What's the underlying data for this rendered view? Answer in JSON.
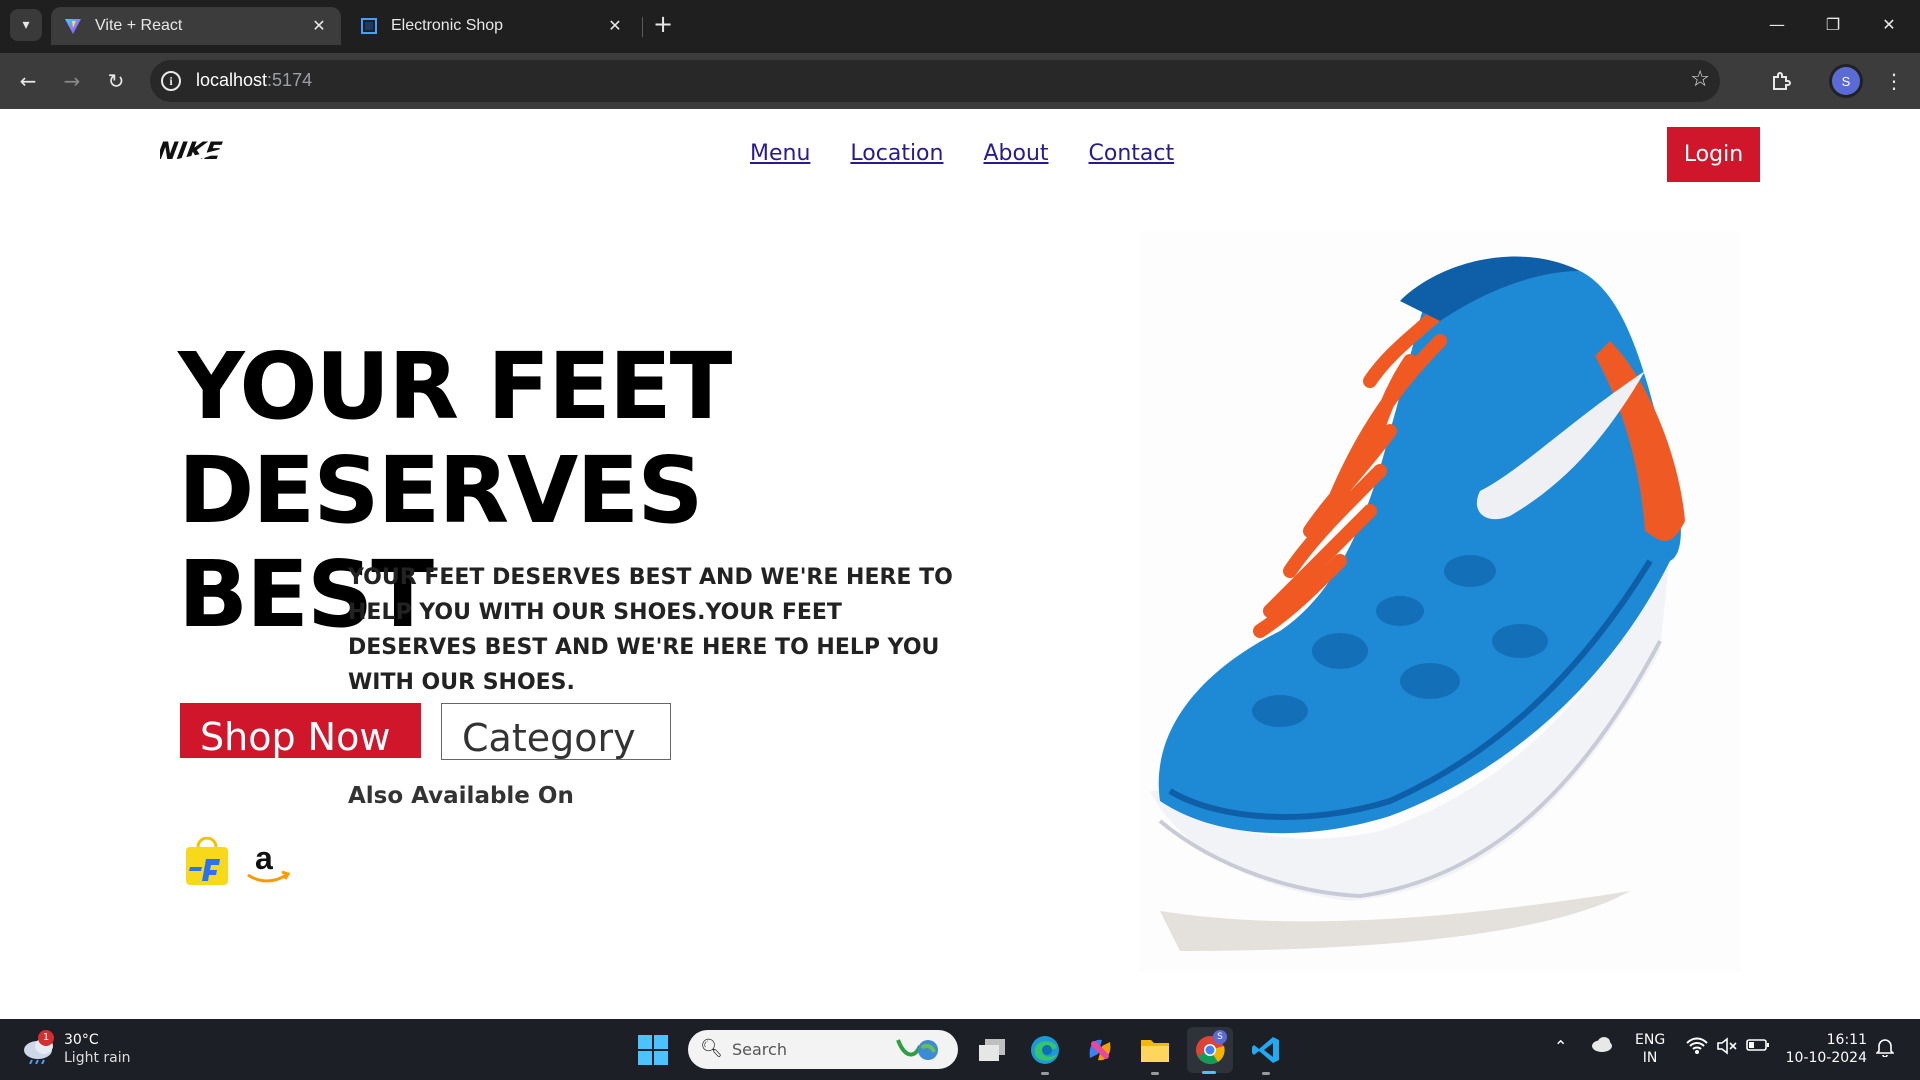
{
  "browser": {
    "tabs": [
      {
        "title": "Vite + React",
        "active": true
      },
      {
        "title": "Electronic Shop",
        "active": false
      }
    ],
    "url_host": "localhost",
    "url_port": ":5174",
    "profile_initial": "S"
  },
  "site": {
    "logo_text": "NIKE",
    "nav": [
      "Menu",
      "Location",
      "About",
      "Contact"
    ],
    "login_label": "Login",
    "hero_title_line1": "YOUR FEET",
    "hero_title_line2": "DESERVES BEST",
    "hero_text": "YOUR FEET DESERVES BEST AND WE'RE HERE TO HELP YOU WITH OUR SHOES.YOUR FEET DESERVES BEST AND WE'RE HERE TO HELP YOU WITH OUR SHOES.",
    "shop_now_label": "Shop Now",
    "category_label": "Category",
    "also_available": "Also Available On",
    "stores": [
      "flipkart-icon",
      "amazon-icon"
    ],
    "accent_color": "#d0162b"
  },
  "taskbar": {
    "weather_temp": "30°C",
    "weather_desc": "Light rain",
    "weather_badge": "1",
    "search_placeholder": "Search",
    "chrome_badge": "S",
    "lang_line1": "ENG",
    "lang_line2": "IN",
    "time": "16:11",
    "date": "10-10-2024"
  }
}
